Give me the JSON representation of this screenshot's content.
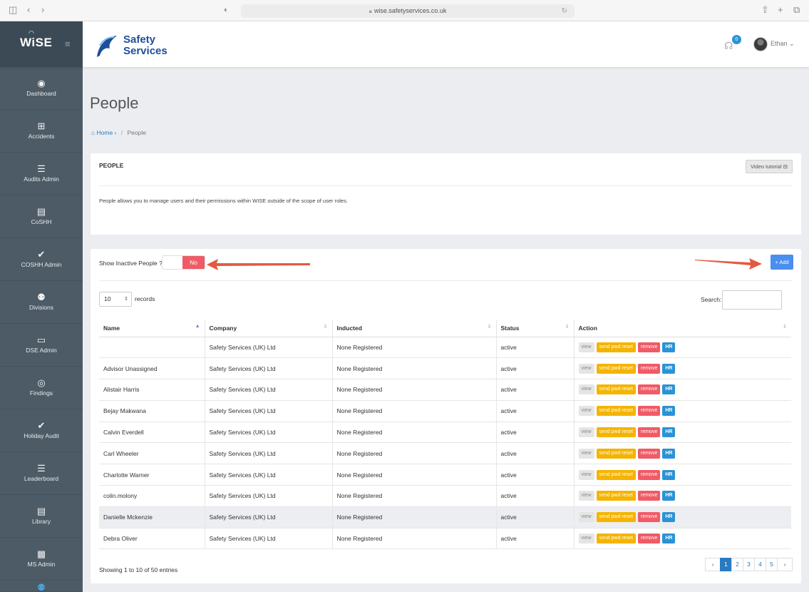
{
  "browser": {
    "url": "wise.safetyservices.co.uk"
  },
  "header": {
    "app_logo": "WiSE",
    "brand_line1": "Safety",
    "brand_line2": "Services",
    "notification_count": "0",
    "user_name": "Ethan ⌄"
  },
  "sidebar": {
    "items": [
      {
        "label": "Dashboard",
        "icon": "dashboard-icon"
      },
      {
        "label": "Accidents",
        "icon": "first-aid-icon"
      },
      {
        "label": "Audits Admin",
        "icon": "list-icon"
      },
      {
        "label": "CoSHH",
        "icon": "book-icon"
      },
      {
        "label": "COSHH Admin",
        "icon": "check-icon"
      },
      {
        "label": "Divisions",
        "icon": "users-icon"
      },
      {
        "label": "DSE Admin",
        "icon": "monitor-icon"
      },
      {
        "label": "Findings",
        "icon": "eye-icon"
      },
      {
        "label": "Holiday Audit",
        "icon": "check-icon"
      },
      {
        "label": "Leaderboard",
        "icon": "list-icon"
      },
      {
        "label": "Library",
        "icon": "book-icon"
      },
      {
        "label": "MS Admin",
        "icon": "document-icon"
      }
    ]
  },
  "page": {
    "title": "People",
    "breadcrumb_home": "Home ›",
    "breadcrumb_sep": "/",
    "breadcrumb_current": "People"
  },
  "info_card": {
    "title": "PEOPLE",
    "video_button": "Video tutorial ⊟",
    "description": "People allows you to manage users and their permissions within WISE outside of the scope of user roles."
  },
  "people_card": {
    "toggle_label": "Show Inactive People ?",
    "toggle_value": "No",
    "add_button": "+ Add",
    "records_value": "10",
    "records_label": "records",
    "search_label": "Search:",
    "columns": [
      "Name",
      "Company",
      "Inducted",
      "Status",
      "Action"
    ],
    "rows": [
      {
        "name": "",
        "company": "Safety Services (UK) Ltd",
        "inducted": "None Registered",
        "status": "active"
      },
      {
        "name": "Advisor Unassigned",
        "company": "Safety Services (UK) Ltd",
        "inducted": "None Registered",
        "status": "active"
      },
      {
        "name": "Alistair Harris",
        "company": "Safety Services (UK) Ltd",
        "inducted": "None Registered",
        "status": "active"
      },
      {
        "name": "Bejay Makwana",
        "company": "Safety Services (UK) Ltd",
        "inducted": "None Registered",
        "status": "active"
      },
      {
        "name": "Calvin Everdell",
        "company": "Safety Services (UK) Ltd",
        "inducted": "None Registered",
        "status": "active"
      },
      {
        "name": "Carl Wheeler",
        "company": "Safety Services (UK) Ltd",
        "inducted": "None Registered",
        "status": "active"
      },
      {
        "name": "Charlotte Warner",
        "company": "Safety Services (UK) Ltd",
        "inducted": "None Registered",
        "status": "active"
      },
      {
        "name": "colin.molony",
        "company": "Safety Services (UK) Ltd",
        "inducted": "None Registered",
        "status": "active"
      },
      {
        "name": "Danielle Mckenzie",
        "company": "Safety Services (UK) Ltd",
        "inducted": "None Registered",
        "status": "active"
      },
      {
        "name": "Debra Oliver",
        "company": "Safety Services (UK) Ltd",
        "inducted": "None Registered",
        "status": "active"
      }
    ],
    "actions": {
      "view": "view",
      "reset": "send pwd reset",
      "remove": "remove",
      "hr": "HR"
    },
    "showing": "Showing 1 to 10 of 50 entries",
    "pagination": {
      "prev": "‹",
      "pages": [
        "1",
        "2",
        "3",
        "4",
        "5"
      ],
      "next": "›",
      "current": "1"
    }
  },
  "colors": {
    "sidebar": "#4d5b66",
    "accent_blue": "#2a7ac0",
    "toggle_no": "#ef5b67",
    "reset_yellow": "#f4b400",
    "annotation_arrow": "#e25b3f"
  }
}
